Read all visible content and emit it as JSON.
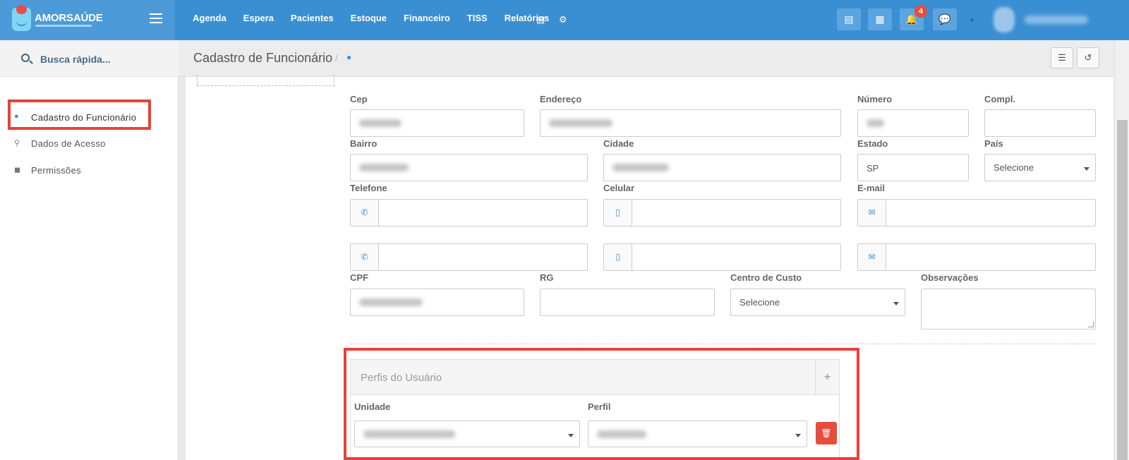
{
  "brand": {
    "name": "AMORSAÚDE"
  },
  "nav": {
    "items": [
      "Agenda",
      "Espera",
      "Pacientes",
      "Estoque",
      "Financeiro",
      "TISS",
      "Relatórios"
    ]
  },
  "notifications": {
    "count": "4"
  },
  "search": {
    "label": "Busca rápida..."
  },
  "sidebar": {
    "items": [
      {
        "label": "Cadastro do Funcionário",
        "icon": "user-icon"
      },
      {
        "label": "Dados de Acesso",
        "icon": "key-icon"
      },
      {
        "label": "Permissões",
        "icon": "lock-icon"
      }
    ]
  },
  "header": {
    "title": "Cadastro de Funcionário",
    "separator": "/"
  },
  "form": {
    "cep": "Cep",
    "endereco": "Endereço",
    "numero": "Número",
    "compl": "Compl.",
    "bairro": "Bairro",
    "cidade": "Cidade",
    "estado": "Estado",
    "estado_value": "SP",
    "pais": "País",
    "pais_value": "Selecione",
    "telefone": "Telefone",
    "celular": "Celular",
    "email": "E-mail",
    "cpf": "CPF",
    "rg": "RG",
    "centro_custo": "Centro de Custo",
    "centro_custo_value": "Selecione",
    "observacoes": "Observações"
  },
  "perfis": {
    "title": "Perfis do Usuário",
    "col_unidade": "Unidade",
    "col_perfil": "Perfil"
  }
}
